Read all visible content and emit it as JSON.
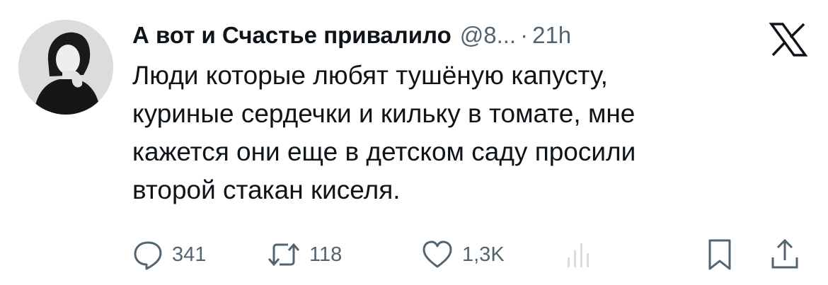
{
  "tweet": {
    "author_name": "А вот и Счастье привалило",
    "handle": "@8...",
    "separator": "·",
    "time": "21h",
    "text_lines": [
      "Люди которые любят тушёную капусту,",
      "куриные сердечки и кильку в томате, мне",
      "кажется они еще в детском саду просили",
      "второй стакан киселя."
    ]
  },
  "actions": {
    "replies": "341",
    "reposts": "118",
    "likes": "1,3K"
  },
  "icons": {
    "avatar": "profile-photo",
    "brand": "x-logo",
    "reply": "speech-bubble-icon",
    "repost": "repost-arrows-icon",
    "like": "heart-icon",
    "views": "bar-chart-icon",
    "bookmark": "bookmark-icon",
    "share": "share-icon"
  },
  "colors": {
    "text": "#0f1419",
    "secondary": "#536471",
    "background": "#ffffff"
  }
}
